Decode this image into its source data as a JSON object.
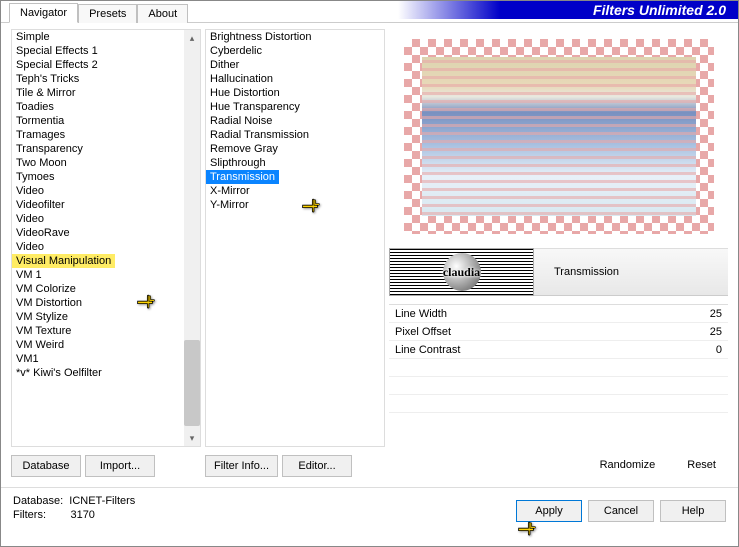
{
  "app_title": "Filters Unlimited 2.0",
  "tabs": {
    "navigator": "Navigator",
    "presets": "Presets",
    "about": "About"
  },
  "categories": [
    "Simple",
    "Special Effects 1",
    "Special Effects 2",
    "Teph's Tricks",
    "Tile & Mirror",
    "Toadies",
    "Tormentia",
    "Tramages",
    "Transparency",
    "Two Moon",
    "Tymoes",
    "Video",
    "Videofilter",
    "Video",
    "VideoRave",
    "Video",
    "Visual Manipulation",
    "VM 1",
    "VM Colorize",
    "VM Distortion",
    "VM Stylize",
    "VM Texture",
    "VM Weird",
    "VM1",
    "*v* Kiwi's Oelfilter"
  ],
  "categories_highlighted_index": 16,
  "filters": [
    "Brightness Distortion",
    "Cyberdelic",
    "Dither",
    "Hallucination",
    "Hue Distortion",
    "Hue Transparency",
    "Radial Noise",
    "Radial Transmission",
    "Remove Gray",
    "Slipthrough",
    "Transmission",
    "X-Mirror",
    "Y-Mirror"
  ],
  "filters_selected_index": 10,
  "buttons": {
    "database": "Database",
    "import": "Import...",
    "filter_info": "Filter Info...",
    "editor": "Editor...",
    "randomize": "Randomize",
    "reset": "Reset",
    "apply": "Apply",
    "cancel": "Cancel",
    "help": "Help"
  },
  "selected_filter_name": "Transmission",
  "params": [
    {
      "label": "Line Width",
      "value": 25
    },
    {
      "label": "Pixel Offset",
      "value": 25
    },
    {
      "label": "Line Contrast",
      "value": 0
    }
  ],
  "logo_text": "claudia",
  "footer": {
    "db_label": "Database:",
    "db_value": "ICNET-Filters",
    "filters_label": "Filters:",
    "filters_value": "3170"
  }
}
